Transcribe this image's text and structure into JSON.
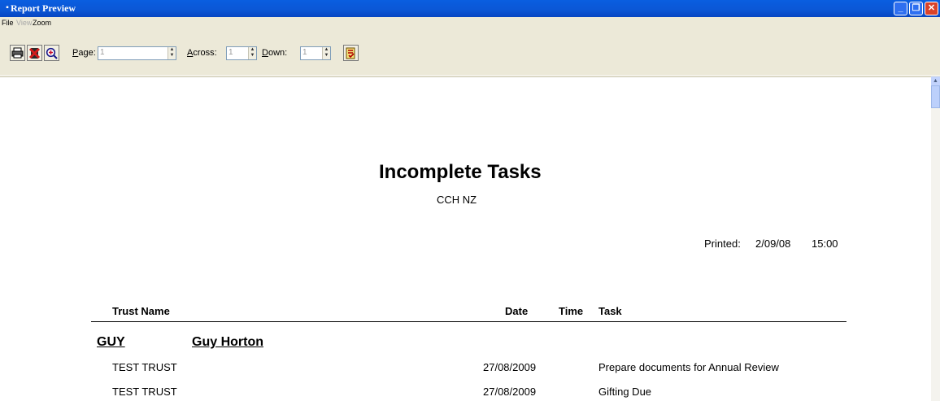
{
  "window": {
    "title": "Report Preview"
  },
  "menu": {
    "items": [
      "File",
      "View",
      "Zoom"
    ]
  },
  "toolbar": {
    "page_label_pre": "",
    "page_label_ul": "P",
    "page_label_post": "age:",
    "page_value": "1",
    "across_label_ul": "A",
    "across_label_post": "cross:",
    "across_value": "1",
    "down_label_ul": "D",
    "down_label_post": "own:",
    "down_value": "1"
  },
  "report": {
    "title": "Incomplete Tasks",
    "subtitle": "CCH NZ",
    "printed_label": "Printed:",
    "printed_date": "2/09/08",
    "printed_time": "15:00",
    "columns": {
      "trust_name": "Trust Name",
      "date": "Date",
      "time": "Time",
      "task": "Task"
    },
    "group": {
      "code": "GUY",
      "name": "Guy Horton"
    },
    "rows": [
      {
        "trust": "TEST TRUST",
        "date": "27/08/2009",
        "time": "",
        "task": "Prepare documents for Annual Review"
      },
      {
        "trust": "TEST TRUST",
        "date": "27/08/2009",
        "time": "",
        "task": "Gifting Due"
      }
    ]
  },
  "icons": [
    "printer-icon",
    "close-report-icon",
    "zoom-in-icon",
    "export-icon",
    "app-icon"
  ]
}
